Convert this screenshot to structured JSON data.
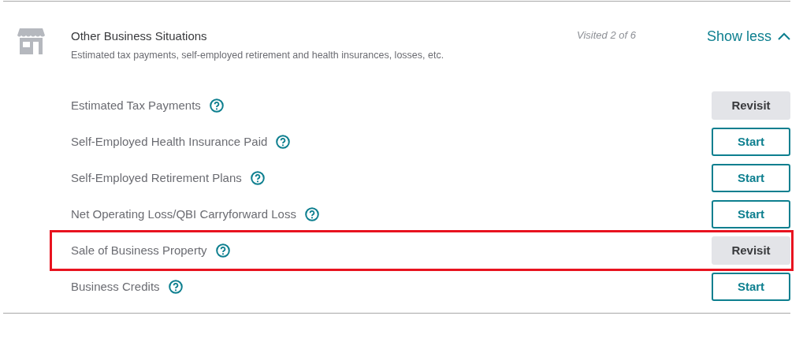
{
  "section": {
    "title": "Other Business Situations",
    "description": "Estimated tax payments, self-employed retirement and health insurances, losses, etc.",
    "progress": "Visited 2 of 6",
    "toggle": {
      "label": "Show less",
      "expanded": true
    }
  },
  "items": [
    {
      "label": "Estimated Tax Payments",
      "button": {
        "kind": "revisit",
        "label": "Revisit"
      },
      "highlighted": false
    },
    {
      "label": "Self-Employed Health Insurance Paid",
      "button": {
        "kind": "start",
        "label": "Start"
      },
      "highlighted": false
    },
    {
      "label": "Self-Employed Retirement Plans",
      "button": {
        "kind": "start",
        "label": "Start"
      },
      "highlighted": false
    },
    {
      "label": "Net Operating Loss/QBI Carryforward Loss",
      "button": {
        "kind": "start",
        "label": "Start"
      },
      "highlighted": false
    },
    {
      "label": "Sale of Business Property",
      "button": {
        "kind": "revisit",
        "label": "Revisit"
      },
      "highlighted": true
    },
    {
      "label": "Business Credits",
      "button": {
        "kind": "start",
        "label": "Start"
      },
      "highlighted": false
    }
  ]
}
